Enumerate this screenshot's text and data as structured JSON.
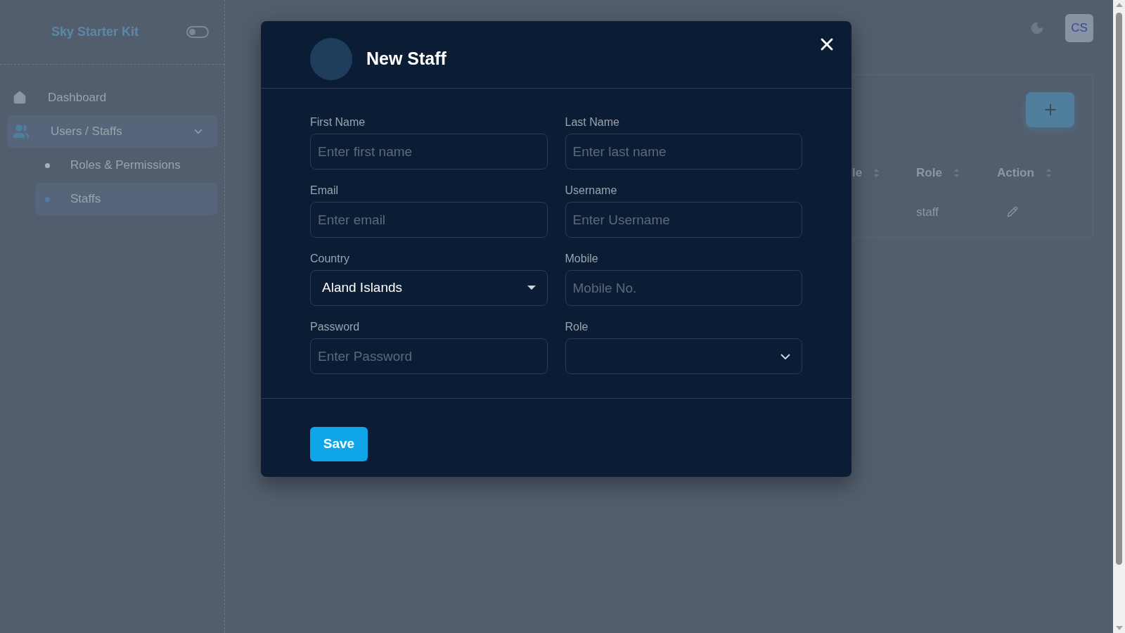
{
  "sidebar": {
    "brand": "Sky Starter Kit",
    "toggle_on": false,
    "items": [
      {
        "kind": "link",
        "label": "Dashboard",
        "selected": false
      },
      {
        "kind": "group",
        "label": "Users / Staffs",
        "expanded": true,
        "selected": true,
        "children": [
          {
            "label": "Roles & Permissions",
            "selected": false
          },
          {
            "label": "Staffs",
            "selected": true
          }
        ]
      }
    ]
  },
  "header": {
    "avatar_initials": "CS"
  },
  "table": {
    "columns": [
      {
        "label": "le"
      },
      {
        "label": "Role"
      },
      {
        "label": "Action"
      }
    ],
    "rows": [
      {
        "cells": [
          {
            "kind": "empty"
          },
          {
            "kind": "text",
            "text": "staff"
          },
          {
            "kind": "edit"
          }
        ]
      }
    ]
  },
  "modal": {
    "title": "New Staff",
    "fields": [
      {
        "kind": "input",
        "label": "First Name",
        "placeholder": "Enter first name"
      },
      {
        "kind": "input",
        "label": "Last Name",
        "placeholder": "Enter last name"
      },
      {
        "kind": "input",
        "label": "Email",
        "placeholder": "Enter email"
      },
      {
        "kind": "input",
        "label": "Username",
        "placeholder": "Enter Username"
      },
      {
        "kind": "country",
        "label": "Country",
        "value": "Aland Islands"
      },
      {
        "kind": "input",
        "label": "Mobile",
        "placeholder": "Mobile No."
      },
      {
        "kind": "input",
        "label": "Password",
        "placeholder": "Enter Password"
      },
      {
        "kind": "select",
        "label": "Role"
      }
    ],
    "save_label": "Save"
  }
}
